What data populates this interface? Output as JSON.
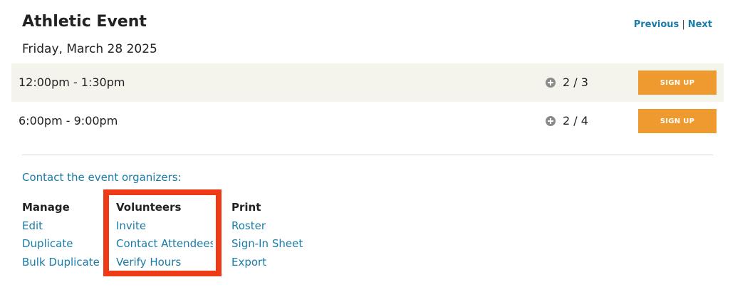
{
  "event": {
    "title": "Athletic Event",
    "date": "Friday, March 28 2025"
  },
  "pager": {
    "previous": "Previous",
    "separator": "|",
    "next": "Next"
  },
  "slots": [
    {
      "time": "12:00pm - 1:30pm",
      "count": "2 / 3",
      "button": "SIGN UP"
    },
    {
      "time": "6:00pm - 9:00pm",
      "count": "2 / 4",
      "button": "SIGN UP"
    }
  ],
  "contact_link": "Contact the event organizers:",
  "manage": {
    "heading": "Manage",
    "items": [
      "Edit",
      "Duplicate",
      "Bulk Duplicate"
    ]
  },
  "volunteers": {
    "heading": "Volunteers",
    "items": [
      "Invite",
      "Contact Attendees",
      "Verify Hours"
    ]
  },
  "print": {
    "heading": "Print",
    "items": [
      "Roster",
      "Sign-In Sheet",
      "Export"
    ]
  },
  "colors": {
    "link": "#1a7ca8",
    "button": "#ef9a2f",
    "shaded_row": "#f5f4ec",
    "highlight_box": "#ee3a17"
  },
  "icons": {
    "slot_count": "plus-circle-icon"
  }
}
